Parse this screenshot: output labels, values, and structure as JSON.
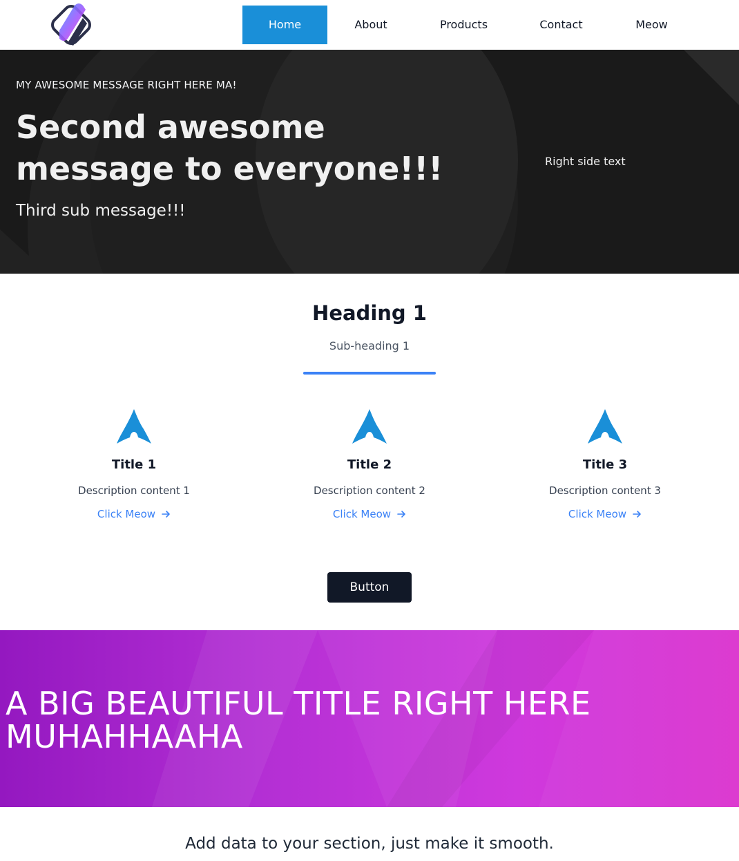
{
  "nav": {
    "items": [
      {
        "label": "Home",
        "active": true
      },
      {
        "label": "About",
        "active": false
      },
      {
        "label": "Products",
        "active": false
      },
      {
        "label": "Contact",
        "active": false
      },
      {
        "label": "Meow",
        "active": false
      }
    ]
  },
  "hero": {
    "kicker": "MY AWESOME MESSAGE RIGHT HERE MA!",
    "title": "Second awesome message to everyone!!!",
    "subtitle": "Third sub message!!!",
    "right_text": "Right side text"
  },
  "features": {
    "heading": "Heading 1",
    "subheading": "Sub-heading 1",
    "cards": [
      {
        "icon": "arch-icon",
        "title": "Title 1",
        "description": "Description content 1",
        "link": "Click Meow"
      },
      {
        "icon": "arch-icon",
        "title": "Title 2",
        "description": "Description content 2",
        "link": "Click Meow"
      },
      {
        "icon": "arch-icon",
        "title": "Title 3",
        "description": "Description content 3",
        "link": "Click Meow"
      }
    ],
    "button": "Button"
  },
  "banner": {
    "title": "A BIG BEAUTIFUL TITLE RIGHT HERE MUHAHHAAHA"
  },
  "footer": {
    "text": "Add data to your section, just make it smooth."
  },
  "colors": {
    "accent": "#1a8fd8",
    "link": "#3b82f6",
    "hero_bg": "#1a1a1a",
    "button_bg": "#111827",
    "banner_start": "#9418c0",
    "banner_end": "#db34cf"
  }
}
